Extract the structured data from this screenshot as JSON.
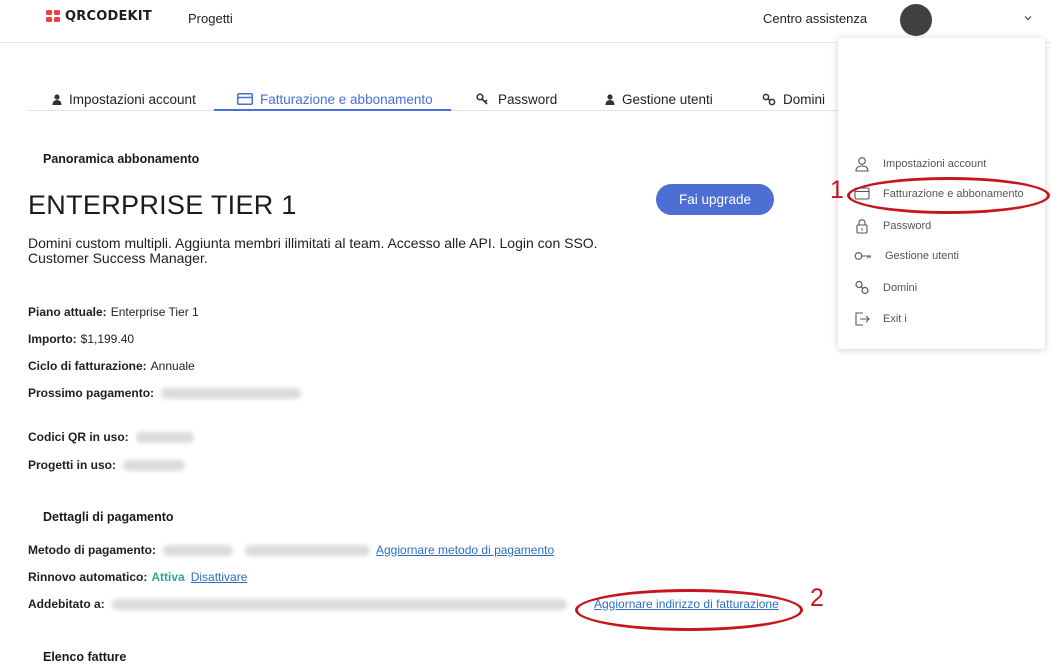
{
  "header": {
    "logo_text": "QRCODEKIT",
    "nav_projects": "Progetti",
    "help_link": "Centro assistenza",
    "brand_color": "#e8443a"
  },
  "tabs": [
    {
      "label": "Impostazioni account",
      "icon": "user-icon"
    },
    {
      "label": "Fatturazione e abbonamento",
      "icon": "card-icon",
      "active": true
    },
    {
      "label": "Password",
      "icon": "key-icon"
    },
    {
      "label": "Gestione utenti",
      "icon": "user-icon"
    },
    {
      "label": "Domini",
      "icon": "link-icon"
    }
  ],
  "subscription": {
    "section_title": "Panoramica abbonamento",
    "tier": "ENTERPRISE TIER 1",
    "upgrade_label": "Fai upgrade",
    "description_line1": "Domini custom multipli. Aggiunta membri illimitati al team. Accesso alle API. Login con SSO.",
    "description_line2": "Customer Success Manager.",
    "plan_label": "Piano attuale:",
    "plan_value": "Enterprise Tier 1",
    "amount_label": "Importo:",
    "amount_value": "$1,199.40",
    "cycle_label": "Ciclo di fatturazione:",
    "cycle_value": "Annuale",
    "next_payment_label": "Prossimo pagamento:",
    "qr_label": "Codici QR in uso:",
    "projects_label": "Progetti in uso:"
  },
  "payment": {
    "section_title": "Dettagli di pagamento",
    "method_label": "Metodo di pagamento:",
    "method_link": "Aggiornare metodo di pagamento",
    "renew_label": "Rinnovo automatico:",
    "renew_status": "Attiva",
    "renew_link": "Disattivare",
    "billed_label": "Addebitato a:",
    "billed_link": "Aggiornare indirizzo di fatturazione"
  },
  "invoices": {
    "section_title": "Elenco fatture"
  },
  "dropdown": {
    "items": [
      {
        "label": "Impostazioni account",
        "icon": "user-outline-icon"
      },
      {
        "label": "Fatturazione e abbonamento",
        "icon": "card-outline-icon"
      },
      {
        "label": "Password",
        "icon": "lock-icon"
      },
      {
        "label": "Gestione utenti",
        "icon": "key-outline-icon"
      },
      {
        "label": "Domini",
        "icon": "link-icon"
      },
      {
        "label": "Exit i",
        "icon": "exit-icon"
      }
    ]
  },
  "annotations": {
    "marker_1": "1",
    "marker_2": "2",
    "color": "#c4161c"
  },
  "colors": {
    "accent": "#4a6fd8",
    "button": "#4d6fd4",
    "link": "#2e6ec3",
    "active_status": "#2fa59a"
  }
}
